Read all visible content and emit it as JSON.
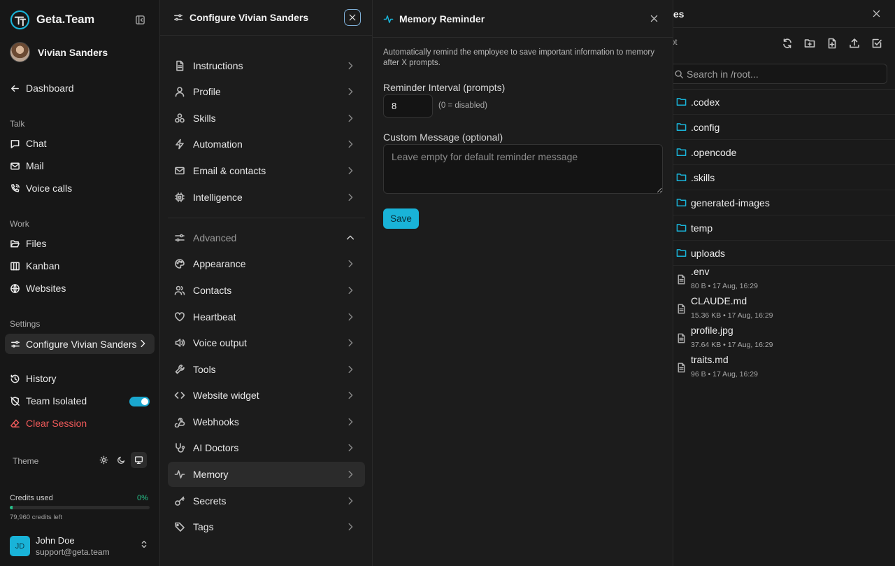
{
  "sidebar": {
    "brand": "Geta.Team",
    "user_name": "Vivian Sanders",
    "dashboard": "Dashboard",
    "talk_label": "Talk",
    "talk_items": [
      "Chat",
      "Mail",
      "Voice calls"
    ],
    "work_label": "Work",
    "work_items": [
      "Files",
      "Kanban",
      "Websites"
    ],
    "settings_label": "Settings",
    "configure": "Configure Vivian Sanders",
    "history": "History",
    "team_isolated": "Team Isolated",
    "team_isolated_on": true,
    "clear_session": "Clear Session",
    "theme_label": "Theme",
    "credits_label": "Credits used",
    "credits_pct": "0%",
    "credits_fraction": 0.0,
    "credits_left": "79,960 credits left",
    "account_initials": "JD",
    "account_name": "John Doe",
    "account_email": "support@geta.team"
  },
  "config": {
    "title": "Configure Vivian Sanders",
    "items": [
      "Instructions",
      "Profile",
      "Skills",
      "Automation",
      "Email & contacts",
      "Intelligence"
    ],
    "advanced_label": "Advanced",
    "advanced_items": [
      "Appearance",
      "Contacts",
      "Heartbeat",
      "Voice output",
      "Tools",
      "Website widget",
      "Webhooks",
      "AI Doctors",
      "Memory",
      "Secrets",
      "Tags"
    ]
  },
  "memory": {
    "title": "Memory Reminder",
    "description": "Automatically remind the employee to save important information to memory after X prompts.",
    "interval_label": "Reminder Interval (prompts)",
    "interval_value": "8",
    "interval_hint": "(0 = disabled)",
    "message_label": "Custom Message (optional)",
    "message_placeholder": "Leave empty for default reminder message",
    "save_label": "Save"
  },
  "files": {
    "title": "les",
    "path": "ot",
    "search_placeholder": "Search in /root...",
    "folders": [
      ".codex",
      ".config",
      ".opencode",
      ".skills",
      "generated-images",
      "temp",
      "uploads"
    ],
    "files": [
      {
        "name": ".env",
        "meta": "80 B • 17 Aug, 16:29"
      },
      {
        "name": "CLAUDE.md",
        "meta": "15.36 KB • 17 Aug, 16:29"
      },
      {
        "name": "profile.jpg",
        "meta": "37.64 KB • 17 Aug, 16:29"
      },
      {
        "name": "traits.md",
        "meta": "96 B • 17 Aug, 16:29"
      }
    ]
  },
  "colors": {
    "accent": "#19b3d8",
    "success": "#27c08a",
    "danger": "#f05a5a"
  }
}
